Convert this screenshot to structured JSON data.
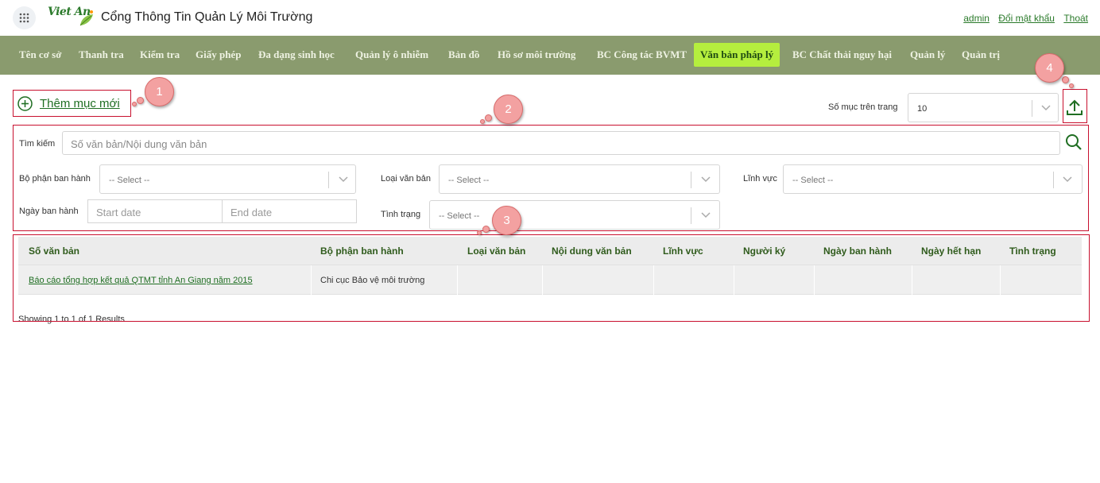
{
  "header": {
    "logo_text": "Viet An",
    "site_title": "Cổng Thông Tin Quản Lý Môi Trường",
    "links": [
      "admin",
      "Đổi mật khẩu",
      "Thoát"
    ]
  },
  "nav": {
    "items": [
      "Tên cơ sở",
      "Thanh tra",
      "Kiểm tra",
      "Giấy phép",
      "Đa dạng sinh học",
      "Quản lý ô nhiễm",
      "Bản đồ",
      "Hồ sơ môi trường",
      "BC Công tác BVMT",
      "Văn bản pháp lý",
      "BC Chất thải nguy hại",
      "Quản lý",
      "Quản trị"
    ],
    "active": "Văn bản pháp lý"
  },
  "toolbar": {
    "add_new_label": "Thêm mục mới",
    "page_size_label": "Số mục trên trang",
    "page_size_value": "10"
  },
  "filters": {
    "search_label": "Tìm kiếm",
    "search_placeholder": "Số văn bản/Nội dung văn bản",
    "issuer_label": "Bộ phận ban hành",
    "doc_type_label": "Loại văn bản",
    "field_label": "Lĩnh vực",
    "issue_date_label": "Ngày ban hành",
    "status_label": "Tình trạng",
    "select_placeholder": "-- Select --",
    "start_date_placeholder": "Start date",
    "end_date_placeholder": "End date"
  },
  "table": {
    "columns": [
      "Số văn bản",
      "Bộ phận ban hành",
      "Loại văn bản",
      "Nội dung văn bản",
      "Lĩnh vực",
      "Người ký",
      "Ngày ban hành",
      "Ngày hết hạn",
      "Tình trạng"
    ],
    "rows": [
      [
        "Báo cáo tổng hợp kết quả QTMT tỉnh An Giang năm 2015",
        "Chi cục Bảo vệ môi trường",
        "",
        "",
        "",
        "",
        "",
        "",
        ""
      ]
    ],
    "results_text": "Showing 1 to 1 of 1 Results"
  },
  "annotations": [
    "1",
    "2",
    "3",
    "4"
  ],
  "colors": {
    "nav_bg": "#8a9b6e",
    "nav_active_bg": "#b5ee3e",
    "accent_green": "#1f6e22",
    "annotation_red": "#c8102e",
    "badge_pink": "#f3a1a1"
  }
}
